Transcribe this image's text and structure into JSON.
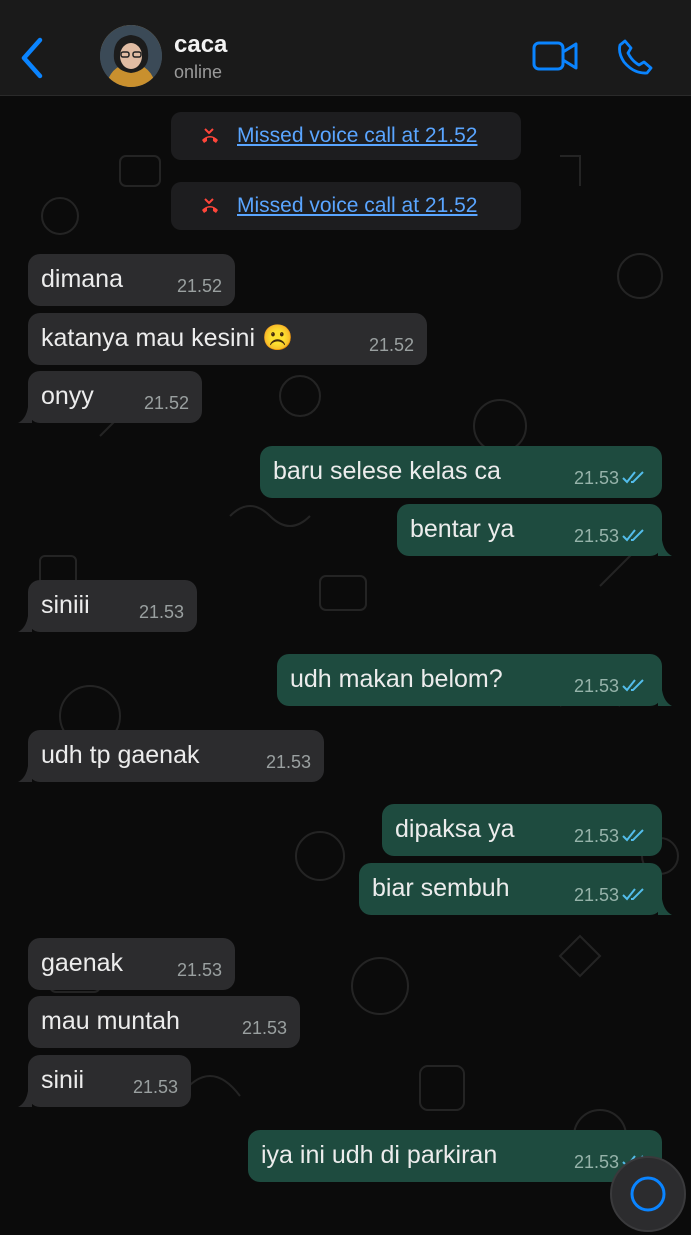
{
  "header": {
    "contact_name": "caca",
    "status": "online",
    "back_icon": "chevron-left-icon",
    "video_icon": "video-camera-icon",
    "call_icon": "phone-icon"
  },
  "colors": {
    "accent": "#0a84ff",
    "incoming_bubble": "#2c2c2e",
    "outgoing_bubble": "#1e4b3f",
    "link": "#5aa5ff",
    "missed_call": "#ff453a",
    "read_tick": "#53bdeb"
  },
  "system_messages": [
    {
      "icon": "missed-call-icon",
      "text": "Missed voice call at 21.52"
    },
    {
      "icon": "missed-call-icon",
      "text": "Missed voice call at 21.52"
    }
  ],
  "messages": [
    {
      "dir": "in",
      "text": "dimana",
      "time": "21.52"
    },
    {
      "dir": "in",
      "text": "katanya mau kesini ☹️",
      "time": "21.52"
    },
    {
      "dir": "in",
      "text": "onyy",
      "time": "21.52"
    },
    {
      "dir": "out",
      "text": "baru selese kelas ca",
      "time": "21.53",
      "status": "read"
    },
    {
      "dir": "out",
      "text": "bentar ya",
      "time": "21.53",
      "status": "read"
    },
    {
      "dir": "in",
      "text": "siniii",
      "time": "21.53"
    },
    {
      "dir": "out",
      "text": "udh makan belom?",
      "time": "21.53",
      "status": "read"
    },
    {
      "dir": "in",
      "text": "udh tp gaenak",
      "time": "21.53"
    },
    {
      "dir": "out",
      "text": "dipaksa ya",
      "time": "21.53",
      "status": "read"
    },
    {
      "dir": "out",
      "text": "biar sembuh",
      "time": "21.53",
      "status": "read"
    },
    {
      "dir": "in",
      "text": "gaenak",
      "time": "21.53"
    },
    {
      "dir": "in",
      "text": "mau muntah",
      "time": "21.53"
    },
    {
      "dir": "in",
      "text": "sinii",
      "time": "21.53"
    },
    {
      "dir": "out",
      "text": "iya ini udh di parkiran",
      "time": "21.53",
      "status": "read"
    }
  ]
}
